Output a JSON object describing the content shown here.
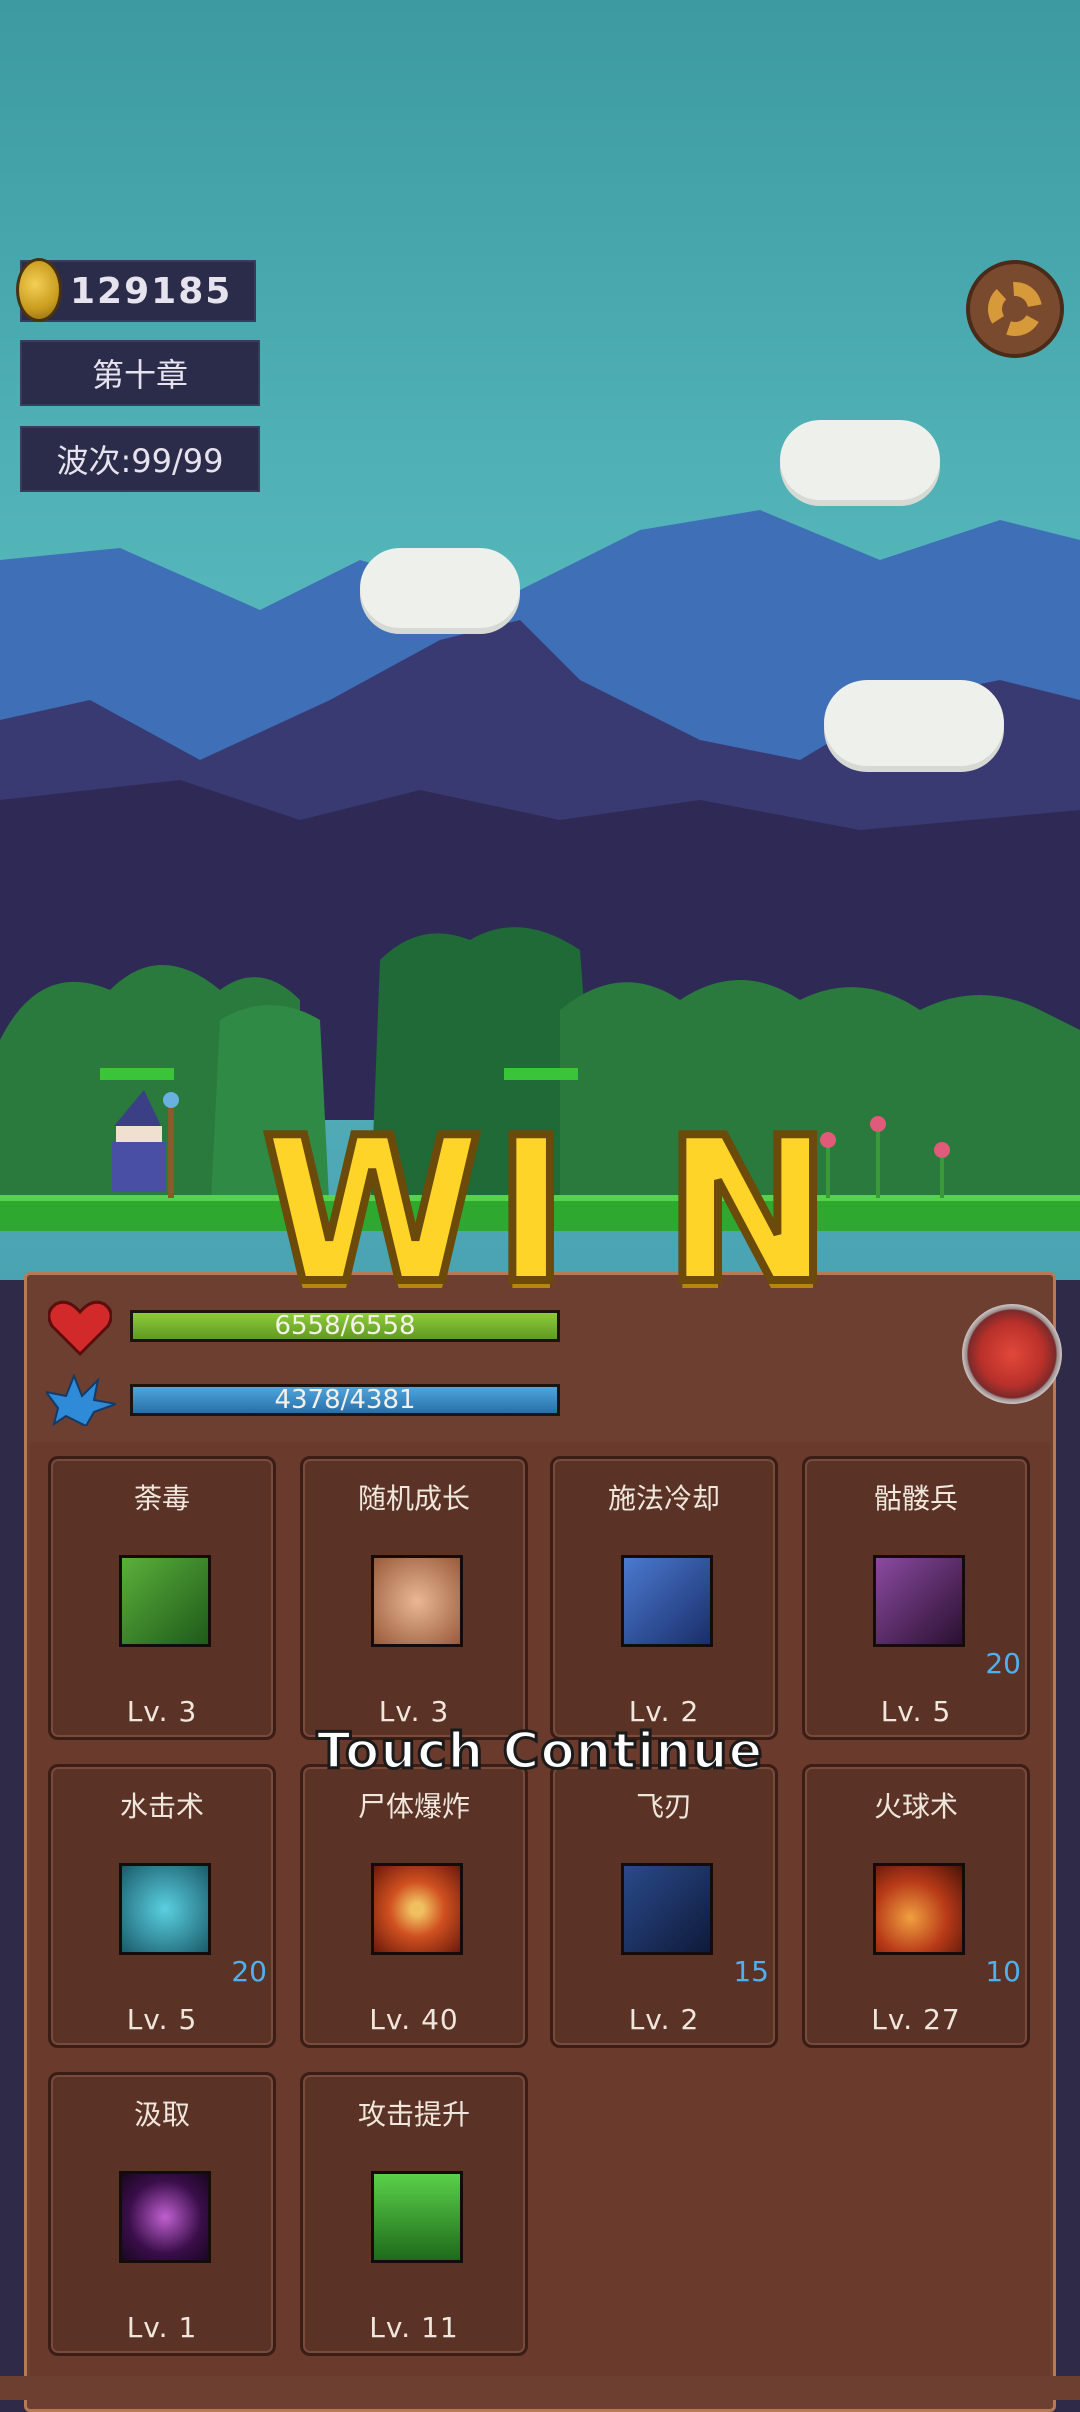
{
  "hud": {
    "coins": "129185",
    "chapter": "第十章",
    "wave": "波次:99/99"
  },
  "player": {
    "hp": "6558/6558",
    "mp": "4378/4381"
  },
  "overlay": {
    "win_letters": [
      "W",
      "I",
      "N"
    ],
    "touch_continue": "Touch Continue"
  },
  "skills": [
    {
      "name": "荼毒",
      "level": "Lv. 3",
      "count": "",
      "icon": "poison-arrow-icon",
      "color": "#3a8a2a"
    },
    {
      "name": "随机成长",
      "level": "Lv. 3",
      "count": "",
      "icon": "fist-icon",
      "color": "#c9946c"
    },
    {
      "name": "施法冷却",
      "level": "Lv. 2",
      "count": "",
      "icon": "lightning-icon",
      "color": "#3a5ea8"
    },
    {
      "name": "骷髅兵",
      "level": "Lv. 5",
      "count": "20",
      "icon": "skeleton-hand-icon",
      "color": "#5a2a6a"
    },
    {
      "name": "水击术",
      "level": "Lv. 5",
      "count": "20",
      "icon": "water-wave-icon",
      "color": "#1f8a9a"
    },
    {
      "name": "尸体爆炸",
      "level": "Lv. 40",
      "count": "",
      "icon": "explosion-icon",
      "color": "#b83a18"
    },
    {
      "name": "飞刃",
      "level": "Lv. 2",
      "count": "15",
      "icon": "flying-blade-icon",
      "color": "#1f3a6a"
    },
    {
      "name": "火球术",
      "level": "Lv. 27",
      "count": "10",
      "icon": "fireball-icon",
      "color": "#c24a18"
    },
    {
      "name": "汲取",
      "level": "Lv. 1",
      "count": "",
      "icon": "vortex-icon",
      "color": "#3a1a4a"
    },
    {
      "name": "攻击提升",
      "level": "Lv. 11",
      "count": "",
      "icon": "arrow-up-icon",
      "color": "#3a9a2a"
    }
  ],
  "colors": {
    "sky": "#4fb0b5",
    "panel": "#6d3f30",
    "win_yellow": "#ffd428",
    "hp_green": "#8fcb3c",
    "mp_blue": "#4ea6e0"
  }
}
